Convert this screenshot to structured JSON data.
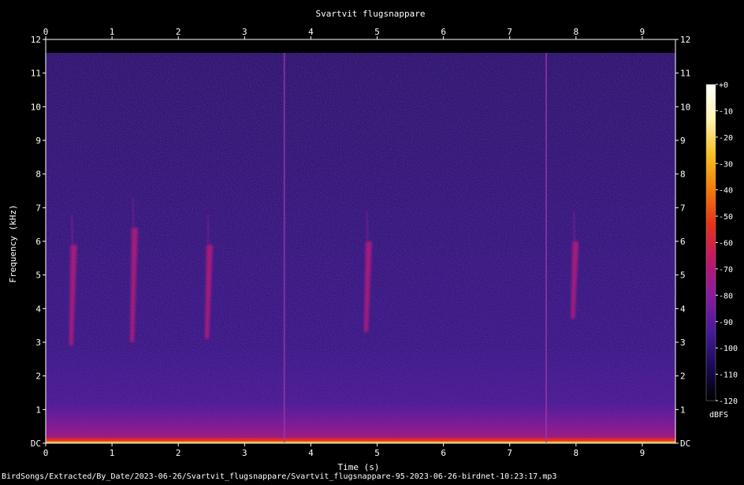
{
  "chart_data": {
    "type": "heatmap",
    "title": "Svartvit flugsnappare",
    "xlabel": "Time (s)",
    "ylabel": "Frequency (kHz)",
    "xlim": [
      0,
      9.5
    ],
    "ylim": [
      0,
      12
    ],
    "x_ticks": [
      "0",
      "1",
      "2",
      "3",
      "4",
      "5",
      "6",
      "7",
      "8",
      "9"
    ],
    "y_ticks": [
      "DC",
      "1",
      "2",
      "3",
      "4",
      "5",
      "6",
      "7",
      "8",
      "9",
      "10",
      "11",
      "12"
    ],
    "colorbar": {
      "label": "dBFS",
      "range": [
        -120,
        0
      ],
      "ticks": [
        "+0",
        "-10",
        "-20",
        "-30",
        "-40",
        "-50",
        "-60",
        "-70",
        "-80",
        "-90",
        "-100",
        "-110",
        "-120"
      ],
      "colors": [
        "#000000",
        "#1a0a5a",
        "#4a1a9c",
        "#8a1aa0",
        "#c0186a",
        "#e8301a",
        "#f47a0a",
        "#f8c020",
        "#fff4b0",
        "#ffffff"
      ]
    },
    "calls": [
      {
        "t": 0.4,
        "f_low": 2.9,
        "f_high": 5.9,
        "f_band": 4.9
      },
      {
        "t": 1.32,
        "f_low": 3.0,
        "f_high": 6.4,
        "f_band": 4.85
      },
      {
        "t": 2.45,
        "f_low": 3.1,
        "f_high": 5.9,
        "f_band": 4.9
      },
      {
        "t": 4.85,
        "f_low": 3.3,
        "f_high": 6.0,
        "f_band": 4.95
      },
      {
        "t": 7.97,
        "f_low": 3.7,
        "f_high": 6.0,
        "f_band": 5.0
      }
    ],
    "clicks": [
      3.6,
      7.55
    ]
  },
  "footer": {
    "filename": "BirdSongs/Extracted/By_Date/2023-06-26/Svartvit_flugsnappare/Svartvit_flugsnappare-95-2023-06-26-birdnet-10:23:17.mp3"
  }
}
